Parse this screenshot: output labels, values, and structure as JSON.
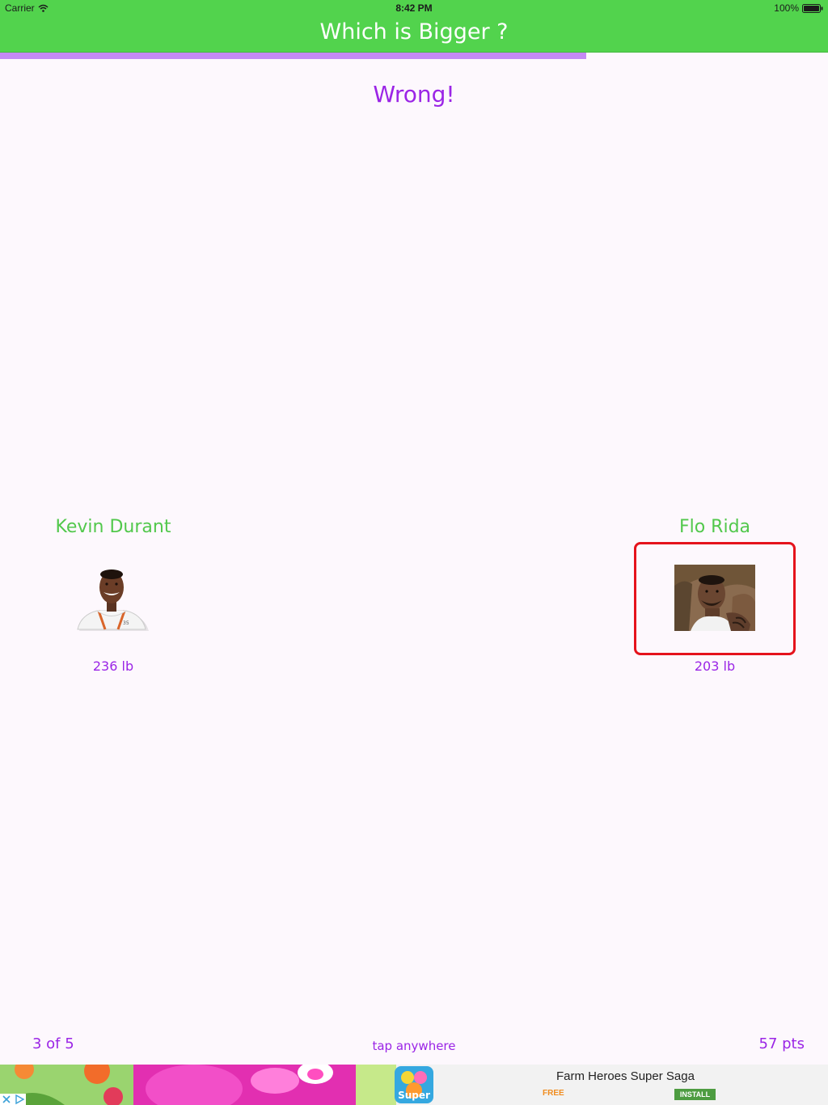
{
  "status_bar": {
    "carrier": "Carrier",
    "time": "8:42 PM",
    "battery": "100%"
  },
  "nav": {
    "title": "Which is Bigger ?"
  },
  "progress": {
    "fraction": 0.708
  },
  "result_text": "Wrong!",
  "contenders": [
    {
      "name": "Kevin Durant",
      "weight": "236 lb"
    },
    {
      "name": "Flo Rida",
      "weight": "203 lb",
      "selected": true
    }
  ],
  "footer": {
    "round": "3 of 5",
    "hint": "tap anywhere",
    "score": "57 pts"
  },
  "ad": {
    "title": "Farm Heroes Super Saga",
    "price": "FREE",
    "install": "INSTALL",
    "app_icon_text": "Super"
  },
  "colors": {
    "nav_green": "#52d34d",
    "accent_purple": "#9b25e6",
    "progress_purple": "#c58af5",
    "name_green": "#52c84c",
    "selection_red": "#e5131c"
  },
  "icons": {
    "wifi": "wifi-icon",
    "battery": "battery-icon",
    "ad_close": "close-icon",
    "ad_choices": "ad-choices-icon"
  }
}
